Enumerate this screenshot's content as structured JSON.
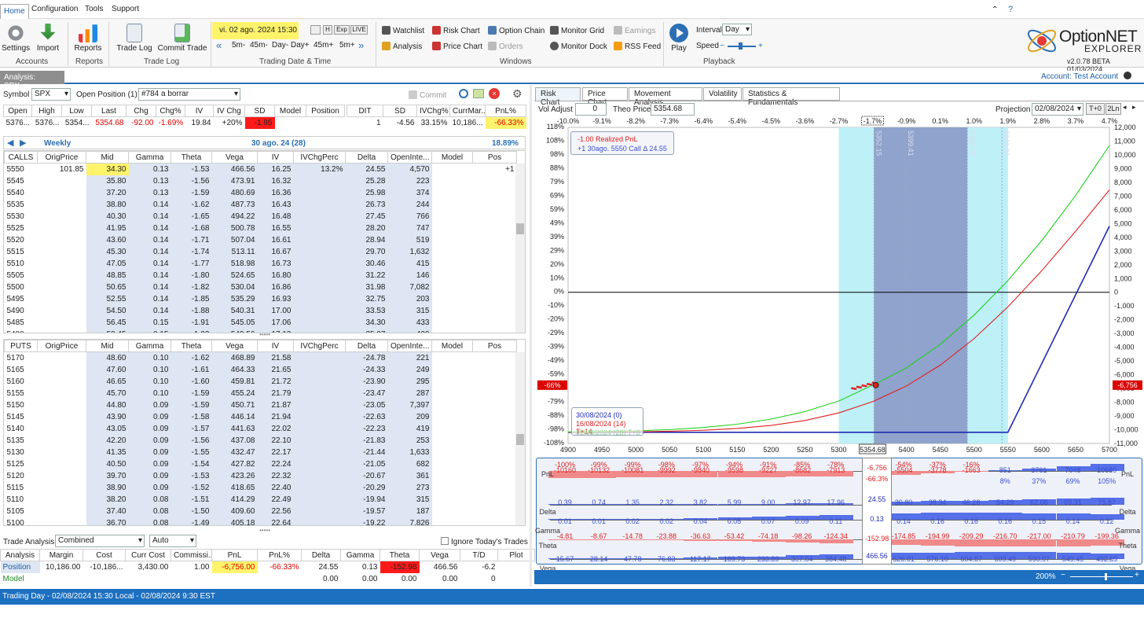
{
  "menu": {
    "home": "Home",
    "configuration": "Configuration",
    "tools": "Tools",
    "support": "Support"
  },
  "ribbon": {
    "settings": "Settings",
    "import": "Import",
    "accounts": "Accounts",
    "reports": "Reports",
    "reports_group": "Reports",
    "trade_log": "Trade Log",
    "commit_trade": "Commit Trade",
    "trade_log_group": "Trade Log",
    "date": "vi. 02 ago. 2024 15:30",
    "date_btns": [
      "H",
      "Exp",
      "LIVE"
    ],
    "steps": [
      "5m-",
      "45m-",
      "Day-",
      "Day+",
      "45m+",
      "5m+"
    ],
    "date_group": "Trading Date & Time",
    "watchlist": "Watchlist",
    "risk_chart": "Risk Chart",
    "option_chain": "Option Chain",
    "monitor_grid": "Monitor Grid",
    "earnings": "Earnings",
    "analysis": "Analysis",
    "price_chart": "Price Chart",
    "orders": "Orders",
    "monitor_dock": "Monitor Dock",
    "rss_feed": "RSS Feed",
    "windows_group": "Windows",
    "play": "Play",
    "interval_label": "Interval",
    "interval_value": "Day",
    "speed_label": "Speed",
    "playback_group": "Playback",
    "brand1": "OptionNET",
    "brand2": "EXPLORER",
    "version": "v2.0.78 BETA 01/03/2024"
  },
  "tabs": {
    "analysis": "Analysis: SPX",
    "account": "Account: Test Account"
  },
  "left": {
    "symbol_label": "Symbol",
    "symbol": "SPX",
    "open_position_label": "Open Position (1)",
    "open_position": "#784 a borrar",
    "commit": "Commit",
    "quote_headers": [
      "Open",
      "High",
      "Low",
      "Last",
      "Chg",
      "Chg%",
      "IV",
      "IV Chg",
      "SD",
      "Model",
      "Position"
    ],
    "quote_values": [
      "5376...",
      "5376...",
      "5354...",
      "5354.68",
      "-92.00",
      "-1.69%",
      "19.84",
      "+20%",
      "-1.95",
      "",
      ""
    ],
    "pos_headers": [
      "DIT",
      "SD",
      "IVChg%",
      "CurrMar...",
      "PnL%"
    ],
    "pos_values": [
      "1",
      "-4.56",
      "33.15%",
      "10,186...",
      "-66.33%"
    ],
    "expiry_label": "Weekly",
    "expiry": "30 ago. 24 (28)",
    "expiry_iv": "18.89%",
    "calls_headers": [
      "CALLS",
      "OrigPrice",
      "Mid",
      "Gamma",
      "Theta",
      "Vega",
      "IV",
      "IVChgPerc",
      "Delta",
      "OpenInte...",
      "Model",
      "Pos"
    ],
    "calls": [
      [
        "5550",
        "101.85",
        "34.30",
        "0.13",
        "-1.53",
        "466.56",
        "16.25",
        "13.2%",
        "24.55",
        "4,570",
        "",
        "+1"
      ],
      [
        "5545",
        "",
        "35.80",
        "0.13",
        "-1.56",
        "473.91",
        "16.32",
        "",
        "25.28",
        "223",
        "",
        ""
      ],
      [
        "5540",
        "",
        "37.20",
        "0.13",
        "-1.59",
        "480.69",
        "16.36",
        "",
        "25.98",
        "374",
        "",
        ""
      ],
      [
        "5535",
        "",
        "38.80",
        "0.14",
        "-1.62",
        "487.73",
        "16.43",
        "",
        "26.73",
        "244",
        "",
        ""
      ],
      [
        "5530",
        "",
        "40.30",
        "0.14",
        "-1.65",
        "494.22",
        "16.48",
        "",
        "27.45",
        "766",
        "",
        ""
      ],
      [
        "5525",
        "",
        "41.95",
        "0.14",
        "-1.68",
        "500.78",
        "16.55",
        "",
        "28.20",
        "747",
        "",
        ""
      ],
      [
        "5520",
        "",
        "43.60",
        "0.14",
        "-1.71",
        "507.04",
        "16.61",
        "",
        "28.94",
        "519",
        "",
        ""
      ],
      [
        "5515",
        "",
        "45.30",
        "0.14",
        "-1.74",
        "513.11",
        "16.67",
        "",
        "29.70",
        "1,632",
        "",
        ""
      ],
      [
        "5510",
        "",
        "47.05",
        "0.14",
        "-1.77",
        "518.98",
        "16.73",
        "",
        "30.46",
        "415",
        "",
        ""
      ],
      [
        "5505",
        "",
        "48.85",
        "0.14",
        "-1.80",
        "524.65",
        "16.80",
        "",
        "31.22",
        "146",
        "",
        ""
      ],
      [
        "5500",
        "",
        "50.65",
        "0.14",
        "-1.82",
        "530.04",
        "16.86",
        "",
        "31.98",
        "7,082",
        "",
        ""
      ],
      [
        "5495",
        "",
        "52.55",
        "0.14",
        "-1.85",
        "535.29",
        "16.93",
        "",
        "32.75",
        "203",
        "",
        ""
      ],
      [
        "5490",
        "",
        "54.50",
        "0.14",
        "-1.88",
        "540.31",
        "17.00",
        "",
        "33.53",
        "315",
        "",
        ""
      ],
      [
        "5485",
        "",
        "56.45",
        "0.15",
        "-1.91",
        "545.05",
        "17.06",
        "",
        "34.30",
        "433",
        "",
        ""
      ],
      [
        "5480",
        "",
        "58.45",
        "0.15",
        "-1.93",
        "549.56",
        "17.13",
        "",
        "35.07",
        "400",
        "",
        ""
      ]
    ],
    "puts_headers": [
      "PUTS",
      "OrigPrice",
      "Mid",
      "Gamma",
      "Theta",
      "Vega",
      "IV",
      "IVChgPerc",
      "Delta",
      "OpenInte...",
      "Model",
      "Pos"
    ],
    "puts": [
      [
        "5170",
        "",
        "48.60",
        "0.10",
        "-1.62",
        "468.89",
        "21.58",
        "",
        "-24.78",
        "221",
        "",
        ""
      ],
      [
        "5165",
        "",
        "47.60",
        "0.10",
        "-1.61",
        "464.33",
        "21.65",
        "",
        "-24.33",
        "249",
        "",
        ""
      ],
      [
        "5160",
        "",
        "46.65",
        "0.10",
        "-1.60",
        "459.81",
        "21.72",
        "",
        "-23.90",
        "295",
        "",
        ""
      ],
      [
        "5155",
        "",
        "45.70",
        "0.10",
        "-1.59",
        "455.24",
        "21.79",
        "",
        "-23.47",
        "287",
        "",
        ""
      ],
      [
        "5150",
        "",
        "44.80",
        "0.09",
        "-1.59",
        "450.71",
        "21.87",
        "",
        "-23.05",
        "7,397",
        "",
        ""
      ],
      [
        "5145",
        "",
        "43.90",
        "0.09",
        "-1.58",
        "446.14",
        "21.94",
        "",
        "-22.63",
        "209",
        "",
        ""
      ],
      [
        "5140",
        "",
        "43.05",
        "0.09",
        "-1.57",
        "441.63",
        "22.02",
        "",
        "-22.23",
        "419",
        "",
        ""
      ],
      [
        "5135",
        "",
        "42.20",
        "0.09",
        "-1.56",
        "437.08",
        "22.10",
        "",
        "-21.83",
        "253",
        "",
        ""
      ],
      [
        "5130",
        "",
        "41.35",
        "0.09",
        "-1.55",
        "432.47",
        "22.17",
        "",
        "-21.44",
        "1,633",
        "",
        ""
      ],
      [
        "5125",
        "",
        "40.50",
        "0.09",
        "-1.54",
        "427.82",
        "22.24",
        "",
        "-21.05",
        "682",
        "",
        ""
      ],
      [
        "5120",
        "",
        "39.70",
        "0.09",
        "-1.53",
        "423.26",
        "22.32",
        "",
        "-20.67",
        "361",
        "",
        ""
      ],
      [
        "5115",
        "",
        "38.90",
        "0.09",
        "-1.52",
        "418.65",
        "22.40",
        "",
        "-20.29",
        "273",
        "",
        ""
      ],
      [
        "5110",
        "",
        "38.20",
        "0.08",
        "-1.51",
        "414.29",
        "22.49",
        "",
        "-19.94",
        "315",
        "",
        ""
      ],
      [
        "5105",
        "",
        "37.40",
        "0.08",
        "-1.50",
        "409.60",
        "22.56",
        "",
        "-19.57",
        "187",
        "",
        ""
      ],
      [
        "5100",
        "",
        "36.70",
        "0.08",
        "-1.49",
        "405.18",
        "22.64",
        "",
        "-19.22",
        "7,826",
        "",
        ""
      ]
    ],
    "trade_analysis_label": "Trade Analysis",
    "trade_mode": "Combined",
    "auto": "Auto",
    "ignore_label": "Ignore Today's Trades",
    "summary_headers": [
      "Analysis",
      "Margin",
      "Cost",
      "Curr Cost",
      "Commissi...",
      "PnL",
      "PnL%",
      "Delta",
      "Gamma",
      "Theta",
      "Vega",
      "T/D",
      "Plot"
    ],
    "summary_position": [
      "Position",
      "10,186.00",
      "-10,186...",
      "3,430.00",
      "1.00",
      "-6,756.00",
      "-66.33%",
      "24.55",
      "0.13",
      "-152.98",
      "466.56",
      "-6.2",
      ""
    ],
    "summary_model": [
      "Model",
      "",
      "",
      "",
      "",
      "",
      "",
      "0.00",
      "0.00",
      "0.00",
      "0.00",
      "0",
      ""
    ]
  },
  "right": {
    "tabs": [
      "Risk Chart",
      "Price Chart",
      "Movement Analysis",
      "Volatility",
      "Statistics & Fundamentals"
    ],
    "vol_adjust_label": "Vol Adjust",
    "vol_adjust": "0",
    "theo_label": "Theo Price",
    "theo": "5354.68",
    "projection_label": "Projection",
    "projection": "02/08/2024",
    "proj_btns": [
      "T+0",
      "2Ln"
    ],
    "legend1": [
      "-1.00 Realized PnL",
      "+1 30ago. 5550 Call Δ 24.55"
    ],
    "legend2": [
      "30/08/2024 (0)",
      "16/08/2024 (14) T+14",
      "02/08/2024 (28) T+0"
    ],
    "top_pct": [
      "-10.0%",
      "-9.1%",
      "-8.2%",
      "-7.3%",
      "-6.4%",
      "-5.4%",
      "-4.5%",
      "-3.6%",
      "-2.7%",
      "-1.7%",
      "-0.9%",
      "0.1%",
      "1.0%",
      "1.9%",
      "2.8%",
      "3.7%",
      "4.7%"
    ],
    "vlines": [
      "5352.15",
      "5399.41",
      "5489.95",
      "5541.21"
    ],
    "current_pnl_pct": "-66%",
    "current_pnl": "-6,756",
    "current_price": "5354.68",
    "greek_labels": [
      "PnL",
      "Delta",
      "Gamma",
      "Theta",
      "Vega"
    ],
    "center_vals": [
      "-6,756",
      "-66.3%",
      "24.55",
      "0.13",
      "-152.98",
      "466.56"
    ],
    "pnl_row1": [
      "-100%",
      "-99%",
      "-99%",
      "-98%",
      "-97%",
      "-94%",
      "-91%",
      "-85%",
      "-78%",
      "",
      "-54%",
      "-37%",
      "-16%",
      "",
      "",
      "",
      ""
    ],
    "pnl_row2": [
      "-10160",
      "-10132",
      "-10081",
      "-9992",
      "-9840",
      "-9598",
      "-9227",
      "-8682",
      "-7913",
      "",
      "-5504",
      "-3778",
      "-1663",
      "851",
      "3761",
      "7048",
      "10680"
    ],
    "pnl_row3": [
      "",
      "",
      "",
      "",
      "",
      "",
      "",
      "",
      "",
      "",
      "",
      "",
      "",
      "8%",
      "37%",
      "69%",
      "105%"
    ],
    "delta_row": [
      "0.39",
      "0.74",
      "1.35",
      "2.32",
      "3.82",
      "5.99",
      "9.00",
      "12.97",
      "17.96",
      "",
      "30.80",
      "38.34",
      "46.28",
      "54.29",
      "62.06",
      "69.31",
      "75.82"
    ],
    "gamma_row": [
      "0.01",
      "0.01",
      "0.02",
      "0.02",
      "0.04",
      "0.05",
      "0.07",
      "0.09",
      "0.11",
      "",
      "0.14",
      "0.16",
      "0.16",
      "0.16",
      "0.15",
      "0.14",
      "0.12"
    ],
    "theta_row": [
      "-4.81",
      "-8.67",
      "-14.78",
      "-23.88",
      "-36.63",
      "-53.42",
      "-74.18",
      "-98.26",
      "-124.34",
      "",
      "-174.85",
      "-194.99",
      "-209.29",
      "-216.70",
      "-217.00",
      "-210.79",
      "-199.36"
    ],
    "vega_row": [
      "15.67",
      "28.14",
      "47.78",
      "76.83",
      "117.17",
      "169.73",
      "233.89",
      "307.04",
      "384.48",
      "",
      "526.01",
      "576.10",
      "604.87",
      "609.49",
      "590.07",
      "549.45",
      "492.59"
    ],
    "zoom": "200%"
  },
  "chart_data": {
    "type": "line",
    "x": [
      4900,
      4950,
      5000,
      5050,
      5100,
      5150,
      5200,
      5250,
      5300,
      5350,
      5400,
      5450,
      5500,
      5550,
      5600,
      5650,
      5700
    ],
    "x_tick_labels": [
      "4900",
      "4950",
      "5000",
      "5050",
      "5100",
      "5150",
      "5200",
      "5250",
      "5300",
      "5354.68",
      "5400",
      "5450",
      "5500",
      "5550",
      "5600",
      "5650",
      "5700"
    ],
    "xlim": [
      4900,
      5700
    ],
    "y_left_ticks": [
      "118%",
      "108%",
      "98%",
      "88%",
      "79%",
      "69%",
      "59%",
      "49%",
      "39%",
      "29%",
      "20%",
      "10%",
      "0%",
      "-10%",
      "-20%",
      "-29%",
      "-39%",
      "-49%",
      "-59%",
      "-69%",
      "-79%",
      "-88%",
      "-98%",
      "-108%"
    ],
    "y_right_ticks": [
      "12,000",
      "11,000",
      "10,000",
      "9,000",
      "8,000",
      "7,000",
      "6,000",
      "5,000",
      "4,000",
      "3,000",
      "2,000",
      "1,000",
      "0",
      "-1,000",
      "-2,000",
      "-3,000",
      "-4,000",
      "-5,000",
      "-6,000",
      "-7,000",
      "-8,000",
      "-9,000",
      "-10,000",
      "-11,000"
    ],
    "ylim": [
      -11000,
      12000
    ],
    "series": [
      {
        "name": "30/08/2024 (0)",
        "color": "#1f2bb0",
        "x": [
          4900,
          5550,
          5700
        ],
        "y": [
          -10186,
          -10186,
          4814
        ]
      },
      {
        "name": "16/08/2024 (14) T+14",
        "color": "#e02020",
        "x": [
          4900,
          4950,
          5000,
          5050,
          5100,
          5150,
          5200,
          5250,
          5300,
          5350,
          5400,
          5450,
          5500,
          5550,
          5600,
          5650,
          5700
        ],
        "y": [
          -10180,
          -10170,
          -10150,
          -10110,
          -10040,
          -9910,
          -9690,
          -9330,
          -8780,
          -7960,
          -6820,
          -5300,
          -3370,
          -1060,
          1570,
          4440,
          7450
        ]
      },
      {
        "name": "02/08/2024 (28) T+0",
        "color": "#20d020",
        "x": [
          4900,
          4950,
          5000,
          5050,
          5100,
          5150,
          5200,
          5250,
          5300,
          5350,
          5400,
          5450,
          5500,
          5550,
          5600,
          5650,
          5700
        ],
        "y": [
          -10160,
          -10132,
          -10081,
          -9992,
          -9840,
          -9598,
          -9227,
          -8682,
          -7913,
          -6756,
          -5504,
          -3778,
          -1663,
          851,
          3761,
          7048,
          10680
        ]
      }
    ],
    "current": {
      "x": 5354.68,
      "y": -6756
    },
    "bands": [
      {
        "from": 5300,
        "to": 5550,
        "color": "#bdf0f7"
      },
      {
        "from": 5352.15,
        "to": 5489.95,
        "color": "#8fa3cc"
      }
    ],
    "zero_line": true
  },
  "status": {
    "text": "Trading Day - 02/08/2024 15:30 Local - 02/08/2024 9:30 EST"
  }
}
